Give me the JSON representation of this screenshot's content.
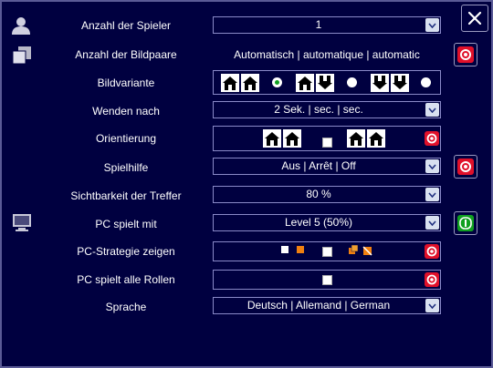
{
  "rows": {
    "players": {
      "label": "Anzahl der Spieler",
      "value": "1"
    },
    "pairs": {
      "label": "Anzahl der Bildpaare",
      "value": "Automatisch | automatique | automatic"
    },
    "variant": {
      "label": "Bildvariante"
    },
    "turn": {
      "label": "Wenden nach",
      "value": "2 Sek. | sec. | sec."
    },
    "orientation": {
      "label": "Orientierung"
    },
    "hint": {
      "label": "Spielhilfe",
      "value": "Aus | Arrêt | Off"
    },
    "visibility": {
      "label": "Sichtbarkeit der Treffer",
      "value": "80 %"
    },
    "pc_plays": {
      "label": "PC spielt mit",
      "value": "Level 5 (50%)"
    },
    "pc_strategy": {
      "label": "PC-Strategie zeigen"
    },
    "pc_all": {
      "label": "PC spielt alle Rollen"
    },
    "language": {
      "label": "Sprache",
      "value": "Deutsch | Allemand | German"
    }
  },
  "colors": {
    "background": "#000040",
    "accent_red": "#e0102a",
    "accent_green": "#10a020",
    "border": "#8a8ac8"
  }
}
